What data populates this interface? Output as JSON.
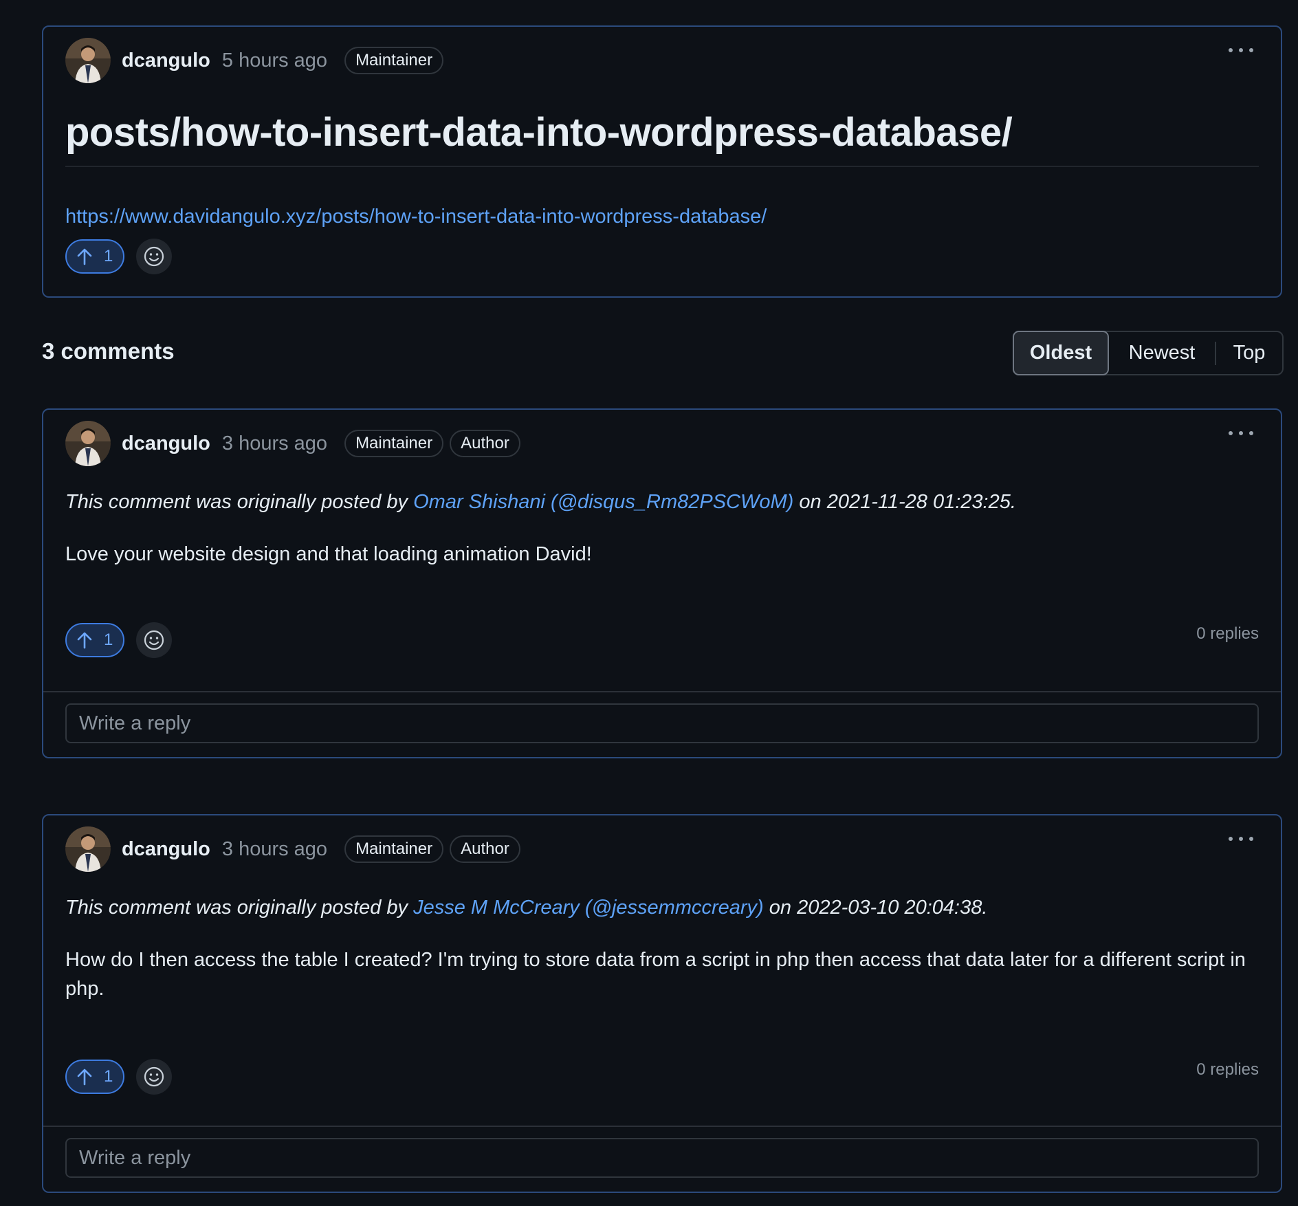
{
  "discussion": {
    "author": "dcangulo",
    "time": "5 hours ago",
    "badges": [
      "Maintainer"
    ],
    "title": "posts/how-to-insert-data-into-wordpress-database/",
    "url": "https://www.davidangulo.xyz/posts/how-to-insert-data-into-wordpress-database/",
    "upvotes": "1",
    "icons": {
      "more": "kebab-menu-icon",
      "upvote": "arrow-up-icon",
      "react": "smiley-icon",
      "avatar": "user-avatar"
    }
  },
  "comments_header": {
    "count_label": "3 comments",
    "sort_options": [
      "Oldest",
      "Newest",
      "Top"
    ],
    "active_sort": "Oldest"
  },
  "comments": [
    {
      "author": "dcangulo",
      "time": "3 hours ago",
      "badges": [
        "Maintainer",
        "Author"
      ],
      "origin_prefix": "This comment was originally posted by ",
      "origin_user": "Omar Shishani (@disqus_Rm82PSCWoM)",
      "origin_suffix": " on 2021-11-28 01:23:25.",
      "body": "Love your website design and that loading animation David!",
      "upvotes": "1",
      "replies": "0 replies",
      "reply_placeholder": "Write a reply"
    },
    {
      "author": "dcangulo",
      "time": "3 hours ago",
      "badges": [
        "Maintainer",
        "Author"
      ],
      "origin_prefix": "This comment was originally posted by ",
      "origin_user": "Jesse M McCreary (@jessemmccreary)",
      "origin_suffix": " on 2022-03-10 20:04:38.",
      "body": "How do I then access the table I created? I'm trying to store data from a script in php then access that data later for a different script in php.",
      "upvotes": "1",
      "replies": "0 replies",
      "reply_placeholder": "Write a reply"
    }
  ],
  "colors": {
    "background": "#0d1117",
    "card_border": "#2b4a7c",
    "link": "#5ea2f7",
    "upvote_border": "#3d7be0",
    "upvote_fill": "#1a2e4f",
    "muted_text": "#8b949e"
  }
}
